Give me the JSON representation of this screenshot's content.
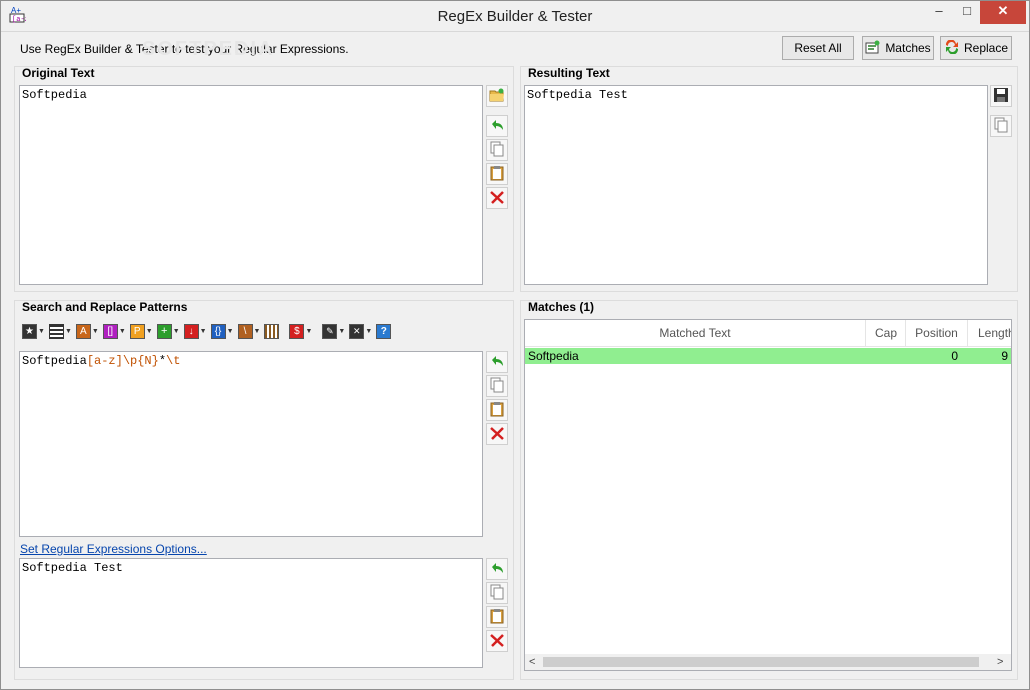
{
  "window": {
    "title": "RegEx Builder & Tester",
    "min": "–",
    "max": "□",
    "close": "✕"
  },
  "header": {
    "intro": "Use RegEx Builder & Tester to test your Regular Expressions.",
    "watermark": "SOFTPEDIA",
    "reset_label": "Reset All",
    "matches_label": "Matches",
    "replace_label": "Replace"
  },
  "original": {
    "label": "Original Text",
    "text": "Softpedia"
  },
  "result": {
    "label": "Resulting Text",
    "text": "Softpedia Test"
  },
  "patterns": {
    "label": "Search and Replace Patterns",
    "search_parts": [
      "Softpedia",
      "[a-z]",
      "\\p{N}",
      "*",
      "\\t"
    ],
    "options_link": "Set Regular Expressions Options...",
    "replace_text": "Softpedia Test"
  },
  "matches": {
    "label": "Matches (1)",
    "columns": [
      "Matched Text",
      "Cap",
      "Position",
      "Length"
    ],
    "rows": [
      {
        "text": "Softpedia",
        "cap": "",
        "position": "0",
        "length": "9"
      }
    ],
    "row_color": "#90ee90"
  },
  "colors": {
    "accent": "#0645ad",
    "close": "#c7463a"
  }
}
